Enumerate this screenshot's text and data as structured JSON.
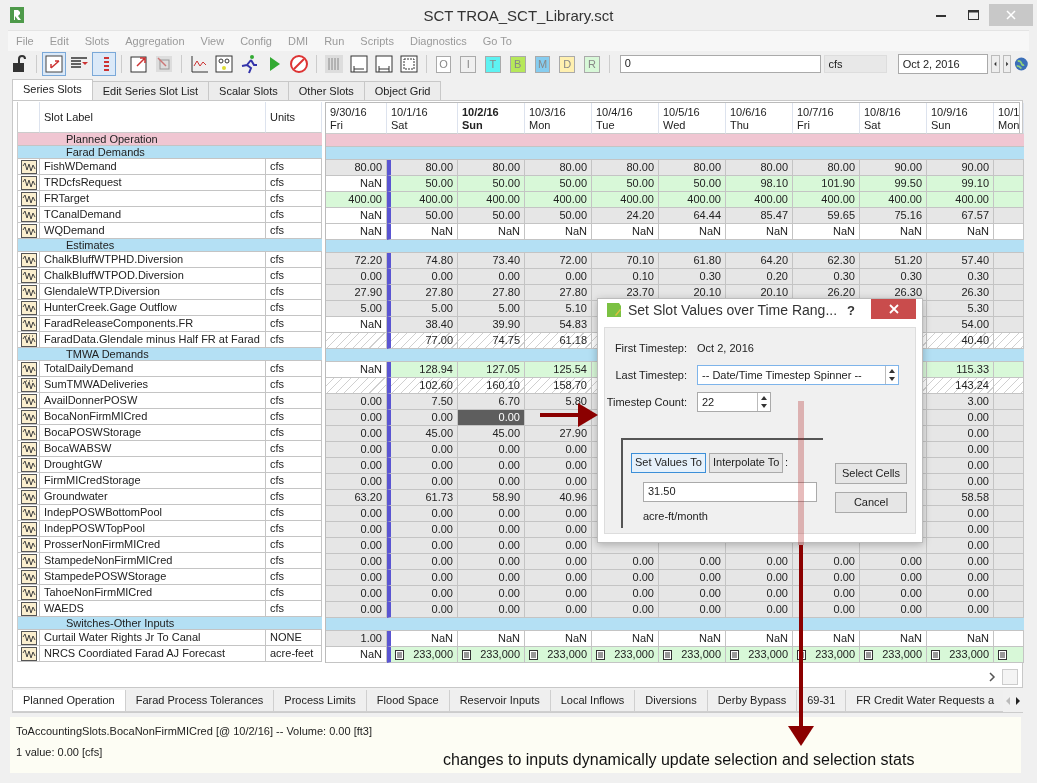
{
  "window": {
    "title": "SCT TROA_SCT_Library.sct"
  },
  "menu": [
    "File",
    "Edit",
    "Slots",
    "Aggregation",
    "View",
    "Config",
    "DMI",
    "Run",
    "Scripts",
    "Diagnostics",
    "Go To"
  ],
  "toolbar": {
    "letter_buttons": [
      {
        "label": "O",
        "color": "#ffffff"
      },
      {
        "label": "I",
        "color": "#f0f0f0"
      },
      {
        "label": "T",
        "color": "#5ef2f2"
      },
      {
        "label": "B",
        "color": "#b6e85a"
      },
      {
        "label": "M",
        "color": "#86cdf0"
      },
      {
        "label": "D",
        "color": "#fff0b0"
      },
      {
        "label": "R",
        "color": "#d8f8d8"
      }
    ],
    "value_field": "0",
    "units": "cfs",
    "date": "Oct 2, 2016"
  },
  "tabs": [
    {
      "label": "Series Slots",
      "selected": true
    },
    {
      "label": "Edit Series Slot List",
      "selected": false
    },
    {
      "label": "Scalar Slots",
      "selected": false
    },
    {
      "label": "Other Slots",
      "selected": false
    },
    {
      "label": "Object Grid",
      "selected": false
    }
  ],
  "table": {
    "label_heading": "Slot Label",
    "units_heading": "Units",
    "columns": [
      {
        "date": "9/30/16",
        "day": "Fri",
        "selected": false
      },
      {
        "date": "10/1/16",
        "day": "Sat",
        "selected": false
      },
      {
        "date": "10/2/16",
        "day": "Sun",
        "selected": true
      },
      {
        "date": "10/3/16",
        "day": "Mon",
        "selected": false
      },
      {
        "date": "10/4/16",
        "day": "Tue",
        "selected": false
      },
      {
        "date": "10/5/16",
        "day": "Wed",
        "selected": false
      },
      {
        "date": "10/6/16",
        "day": "Thu",
        "selected": false
      },
      {
        "date": "10/7/16",
        "day": "Fri",
        "selected": false
      },
      {
        "date": "10/8/16",
        "day": "Sat",
        "selected": false
      },
      {
        "date": "10/9/16",
        "day": "Sun",
        "selected": false
      },
      {
        "date": "10/1",
        "day": "Mon",
        "selected": false
      }
    ],
    "rows": [
      {
        "kind": "group",
        "label": "Planned Operation",
        "color": "#f0c6d2"
      },
      {
        "kind": "group",
        "label": "Farad Demands",
        "color": "#b4e0f4"
      },
      {
        "kind": "slot",
        "label": "FishWDemand",
        "units": "cfs",
        "initial": {
          "value": "80.00",
          "color": "#e6e6e6"
        },
        "color": "#e6e6e6",
        "values": [
          "80.00",
          "80.00",
          "80.00",
          "80.00",
          "80.00",
          "80.00",
          "80.00",
          "90.00",
          "90.00"
        ]
      },
      {
        "kind": "slot",
        "label": "TRDcfsRequest",
        "units": "cfs",
        "initial": {
          "value": "NaN",
          "color": "#ffffff"
        },
        "color": "#d8f8d8",
        "values": [
          "50.00",
          "50.00",
          "50.00",
          "50.00",
          "50.00",
          "98.10",
          "101.90",
          "99.50",
          "99.10"
        ]
      },
      {
        "kind": "slot",
        "label": "FRTarget",
        "units": "cfs",
        "initial": {
          "value": "400.00",
          "color": "#d8f8d8"
        },
        "color": "#d8f8d8",
        "values": [
          "400.00",
          "400.00",
          "400.00",
          "400.00",
          "400.00",
          "400.00",
          "400.00",
          "400.00",
          "400.00"
        ]
      },
      {
        "kind": "slot",
        "label": "TCanalDemand",
        "units": "cfs",
        "initial": {
          "value": "NaN",
          "color": "#ffffff"
        },
        "color": "#e6e6e6",
        "values": [
          "50.00",
          "50.00",
          "50.00",
          "24.20",
          "64.44",
          "85.47",
          "59.65",
          "75.16",
          "67.57"
        ]
      },
      {
        "kind": "slot",
        "label": "WQDemand",
        "units": "cfs",
        "initial": {
          "value": "NaN",
          "color": "#ffffff"
        },
        "color": "#ffffff",
        "values": [
          "NaN",
          "NaN",
          "NaN",
          "NaN",
          "NaN",
          "NaN",
          "NaN",
          "NaN",
          "NaN"
        ]
      },
      {
        "kind": "group",
        "label": "Estimates",
        "color": "#b4e0f4"
      },
      {
        "kind": "slot",
        "label": "ChalkBluffWTPHD.Diversion",
        "units": "cfs",
        "initial": {
          "value": "72.20",
          "color": "#e6e6e6"
        },
        "color": "#e6e6e6",
        "values": [
          "74.80",
          "73.40",
          "72.00",
          "70.10",
          "61.80",
          "64.20",
          "62.30",
          "51.20",
          "57.40"
        ]
      },
      {
        "kind": "slot",
        "label": "ChalkBluffWTPOD.Diversion",
        "units": "cfs",
        "initial": {
          "value": "0.00",
          "color": "#e6e6e6"
        },
        "color": "#e6e6e6",
        "values": [
          "0.00",
          "0.00",
          "0.00",
          "0.10",
          "0.30",
          "0.20",
          "0.30",
          "0.30",
          "0.30"
        ]
      },
      {
        "kind": "slot",
        "label": "GlendaleWTP.Diversion",
        "units": "cfs",
        "initial": {
          "value": "27.90",
          "color": "#e6e6e6"
        },
        "color": "#e6e6e6",
        "values": [
          "27.80",
          "27.80",
          "27.80",
          "23.70",
          "20.10",
          "20.10",
          "26.20",
          "26.30",
          "26.30"
        ]
      },
      {
        "kind": "slot",
        "label": "HunterCreek.Gage Outflow",
        "units": "cfs",
        "initial": {
          "value": "5.00",
          "color": "#e6e6e6"
        },
        "color": "#e6e6e6",
        "values": [
          "5.00",
          "5.00",
          "5.10"
        ],
        "right_values": [
          "5.30"
        ]
      },
      {
        "kind": "slot",
        "label": "FaradReleaseComponents.FR",
        "units": "cfs",
        "initial": {
          "value": "NaN",
          "color": "#ffffff"
        },
        "color": "#e6e6e6",
        "values": [
          "38.40",
          "39.90",
          "54.83"
        ],
        "right_values": [
          "54.00"
        ]
      },
      {
        "kind": "aggregate_slot",
        "label": "FaradData.Glendale minus Half FR at Farad",
        "units": "cfs",
        "values": [
          "77.00",
          "74.75",
          "61.18"
        ],
        "right_values": [
          "40.40"
        ]
      },
      {
        "kind": "group",
        "label": "TMWA Demands",
        "color": "#b4e0f4"
      },
      {
        "kind": "slot",
        "label": "TotalDailyDemand",
        "units": "cfs",
        "initial": {
          "value": "NaN",
          "color": "#ffffff"
        },
        "color": "#d8f8d8",
        "values": [
          "128.94",
          "127.05",
          "125.54"
        ],
        "right_values": [
          "115.33"
        ]
      },
      {
        "kind": "aggregate_slot",
        "label": "SumTMWADeliveries",
        "units": "cfs",
        "values": [
          "102.60",
          "160.10",
          "158.70"
        ],
        "right_values": [
          "143.24"
        ]
      },
      {
        "kind": "slot",
        "label": "AvailDonnerPOSW",
        "units": "cfs",
        "initial": {
          "value": "0.00",
          "color": "#e6e6e6"
        },
        "color": "#e6e6e6",
        "values": [
          "7.50",
          "6.70",
          "5.80"
        ],
        "right_values": [
          "3.00"
        ]
      },
      {
        "kind": "slot",
        "label": "BocaNonFirmMICred",
        "units": "cfs",
        "initial": {
          "value": "0.00",
          "color": "#e6e6e6"
        },
        "color": "#e6e6e6",
        "values": [
          "0.00",
          {
            "value": "0.00",
            "selected": true
          }
        ],
        "right_values": [
          "0.00"
        ]
      },
      {
        "kind": "slot",
        "label": "BocaPOSWStorage",
        "units": "cfs",
        "initial": {
          "value": "0.00",
          "color": "#e6e6e6"
        },
        "color": "#e6e6e6",
        "values": [
          "45.00",
          "45.00",
          "27.90"
        ],
        "right_values": [
          "0.00"
        ]
      },
      {
        "kind": "slot",
        "label": "BocaWABSW",
        "units": "cfs",
        "initial": {
          "value": "0.00",
          "color": "#e6e6e6"
        },
        "color": "#e6e6e6",
        "values": [
          "0.00",
          "0.00",
          "0.00"
        ],
        "right_values": [
          "0.00"
        ]
      },
      {
        "kind": "slot",
        "label": "DroughtGW",
        "units": "cfs",
        "initial": {
          "value": "0.00",
          "color": "#e6e6e6"
        },
        "color": "#e6e6e6",
        "values": [
          "0.00",
          "0.00",
          "0.00"
        ],
        "right_values": [
          "0.00"
        ]
      },
      {
        "kind": "slot",
        "label": "FirmMICredStorage",
        "units": "cfs",
        "initial": {
          "value": "0.00",
          "color": "#e6e6e6"
        },
        "color": "#e6e6e6",
        "values": [
          "0.00",
          "0.00",
          "0.00"
        ],
        "right_values": [
          "0.00"
        ]
      },
      {
        "kind": "slot",
        "label": "Groundwater",
        "units": "cfs",
        "initial": {
          "value": "63.20",
          "color": "#e6e6e6"
        },
        "color": "#e6e6e6",
        "values": [
          "61.73",
          "58.90",
          "40.96"
        ],
        "right_values": [
          "58.58"
        ]
      },
      {
        "kind": "slot",
        "label": "IndepPOSWBottomPool",
        "units": "cfs",
        "initial": {
          "value": "0.00",
          "color": "#e6e6e6"
        },
        "color": "#e6e6e6",
        "values": [
          "0.00",
          "0.00",
          "0.00"
        ],
        "right_values": [
          "0.00"
        ]
      },
      {
        "kind": "slot",
        "label": "IndepPOSWTopPool",
        "units": "cfs",
        "initial": {
          "value": "0.00",
          "color": "#e6e6e6"
        },
        "color": "#e6e6e6",
        "values": [
          "0.00",
          "0.00",
          "0.00"
        ],
        "right_values": [
          "0.00"
        ]
      },
      {
        "kind": "slot",
        "label": "ProsserNonFirmMICred",
        "units": "cfs",
        "initial": {
          "value": "0.00",
          "color": "#e6e6e6"
        },
        "color": "#e6e6e6",
        "values": [
          "0.00",
          "0.00",
          "0.00"
        ],
        "right_values": [
          "0.00"
        ]
      },
      {
        "kind": "slot",
        "label": "StampedeNonFirmMICred",
        "units": "cfs",
        "initial": {
          "value": "0.00",
          "color": "#e6e6e6"
        },
        "color": "#e6e6e6",
        "values": [
          "0.00",
          "0.00",
          "0.00",
          "0.00",
          "0.00",
          "0.00",
          "0.00",
          "0.00",
          "0.00"
        ]
      },
      {
        "kind": "slot",
        "label": "StampedePOSWStorage",
        "units": "cfs",
        "initial": {
          "value": "0.00",
          "color": "#e6e6e6"
        },
        "color": "#e6e6e6",
        "values": [
          "0.00",
          "0.00",
          "0.00",
          "0.00",
          "0.00",
          "0.00",
          "0.00",
          "0.00",
          "0.00"
        ]
      },
      {
        "kind": "slot",
        "label": "TahoeNonFirmMICred",
        "units": "cfs",
        "initial": {
          "value": "0.00",
          "color": "#e6e6e6"
        },
        "color": "#e6e6e6",
        "values": [
          "0.00",
          "0.00",
          "0.00",
          "0.00",
          "0.00",
          "0.00",
          "0.00",
          "0.00",
          "0.00"
        ]
      },
      {
        "kind": "slot",
        "label": "WAEDS",
        "units": "cfs",
        "initial": {
          "value": "0.00",
          "color": "#e6e6e6"
        },
        "color": "#e6e6e6",
        "values": [
          "0.00",
          "0.00",
          "0.00",
          "0.00",
          "0.00",
          "0.00",
          "0.00",
          "0.00",
          "0.00"
        ]
      },
      {
        "kind": "group",
        "label": "Switches-Other Inputs",
        "color": "#b4e0f4"
      },
      {
        "kind": "slot",
        "label": "Curtail Water Rights Jr To Canal",
        "units": "NONE",
        "initial": {
          "value": "1.00",
          "color": "#e6e6e6"
        },
        "color": "#ffffff",
        "values": [
          "NaN",
          "NaN",
          "NaN",
          "NaN",
          "NaN",
          "NaN",
          "NaN",
          "NaN",
          "NaN"
        ]
      },
      {
        "kind": "note_slot",
        "label": "NRCS Coordiated Farad AJ Forecast",
        "units": "acre-feet",
        "initial": {
          "value": "NaN",
          "color": "#ffffff"
        },
        "color": "#d8f8d8",
        "values": [
          "233,000",
          "233,000",
          "233,000",
          "233,000",
          "233,000",
          "233,000",
          "233,000",
          "233,000",
          "233,000"
        ]
      }
    ]
  },
  "bottom_tabs": [
    {
      "label": "Planned Operation",
      "selected": true
    },
    {
      "label": "Farad Process Tolerances",
      "selected": false
    },
    {
      "label": "Process Limits",
      "selected": false
    },
    {
      "label": "Flood Space",
      "selected": false
    },
    {
      "label": "Reservoir Inputs",
      "selected": false
    },
    {
      "label": "Local Inflows",
      "selected": false
    },
    {
      "label": "Diversions",
      "selected": false
    },
    {
      "label": "Derby Bypass",
      "selected": false
    },
    {
      "label": "69-31",
      "selected": false
    },
    {
      "label": "FR Credit Water Requests a",
      "selected": false
    }
  ],
  "status": [
    "ToAccountingSlots.BocaNonFirmMICred [@ 10/2/16] -- Volume: 0.00 [ft3]",
    "1 value:  0.00 [cfs]"
  ],
  "dialog": {
    "title": "Set Slot Values over Time Rang...",
    "help": "?",
    "first_timestep_label": "First Timestep:",
    "first_timestep": "Oct 2, 2016",
    "last_timestep_label": "Last Timestep:",
    "last_timestep": "-- Date/Time Timestep Spinner --",
    "count_label": "Timestep Count:",
    "count": "22",
    "mode_buttons": [
      {
        "label": "Set Values To",
        "selected": true
      },
      {
        "label": "Interpolate To",
        "selected": false
      }
    ],
    "colon": ":",
    "value": "31.50",
    "value_units": "acre-ft/month",
    "buttons": [
      "Select Cells",
      "Cancel"
    ]
  },
  "annotation": "changes to inputs dynamically update selection and selection stats"
}
